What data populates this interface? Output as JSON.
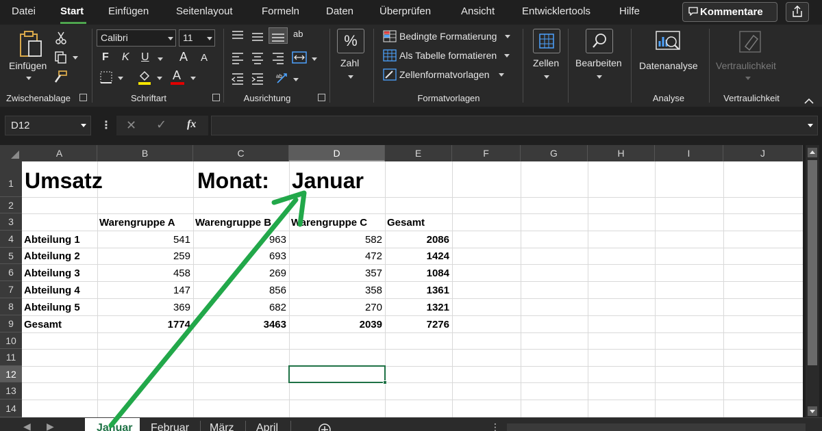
{
  "menu": {
    "items": [
      "Datei",
      "Start",
      "Einfügen",
      "Seitenlayout",
      "Formeln",
      "Daten",
      "Überprüfen",
      "Ansicht",
      "Entwicklertools",
      "Hilfe"
    ],
    "active": "Start",
    "comment_label": "Kommentare"
  },
  "ribbon": {
    "clipboard": {
      "paste_label": "Einfügen",
      "group_label": "Zwischenablage"
    },
    "font": {
      "name": "Calibri",
      "size": "11",
      "bold": "F",
      "italic": "K",
      "underline": "U",
      "grow": "A",
      "shrink": "A",
      "font_color_letter": "A",
      "group_label": "Schriftart"
    },
    "alignment": {
      "group_label": "Ausrichtung",
      "wrap_glyph": "ab"
    },
    "number": {
      "label": "Zahl",
      "glyph": "%"
    },
    "styles": {
      "conditional": "Bedingte Formatierung",
      "as_table": "Als Tabelle formatieren",
      "cell_styles": "Zellenformatvorlagen",
      "group_label": "Formatvorlagen"
    },
    "cells": {
      "label": "Zellen"
    },
    "editing": {
      "label": "Bearbeiten"
    },
    "analysis": {
      "label": "Datenanalyse",
      "group_label": "Analyse"
    },
    "sensitivity": {
      "label": "Vertraulichkeit",
      "group_label": "Vertraulichkeit"
    }
  },
  "formula_bar": {
    "name_box": "D12",
    "fx": "fx",
    "formula": ""
  },
  "columns": [
    "A",
    "B",
    "C",
    "D",
    "E",
    "F",
    "G",
    "H",
    "I",
    "J"
  ],
  "selected_column": "D",
  "rows": [
    "1",
    "2",
    "3",
    "4",
    "5",
    "6",
    "7",
    "8",
    "9",
    "10",
    "11",
    "12",
    "13",
    "14"
  ],
  "selected_row": "12",
  "sheet": {
    "title": "Umsatz",
    "month_label": "Monat:",
    "month_value": "Januar",
    "headers": [
      "Warengruppe A",
      "Warengruppe B",
      "Warengruppe C",
      "Gesamt"
    ],
    "data_rows": [
      {
        "label": "Abteilung 1",
        "values": [
          "541",
          "963",
          "582",
          "2086"
        ]
      },
      {
        "label": "Abteilung 2",
        "values": [
          "259",
          "693",
          "472",
          "1424"
        ]
      },
      {
        "label": "Abteilung 3",
        "values": [
          "458",
          "269",
          "357",
          "1084"
        ]
      },
      {
        "label": "Abteilung 4",
        "values": [
          "147",
          "856",
          "358",
          "1361"
        ]
      },
      {
        "label": "Abteilung 5",
        "values": [
          "369",
          "682",
          "270",
          "1321"
        ]
      }
    ],
    "total_row": {
      "label": "Gesamt",
      "values": [
        "1774",
        "3463",
        "2039",
        "7276"
      ]
    }
  },
  "tabs": [
    "Januar",
    "Februar",
    "März",
    "April"
  ],
  "active_tab": "Januar",
  "annotation": {
    "color": "#22a84a",
    "icon": "green-arrow"
  }
}
